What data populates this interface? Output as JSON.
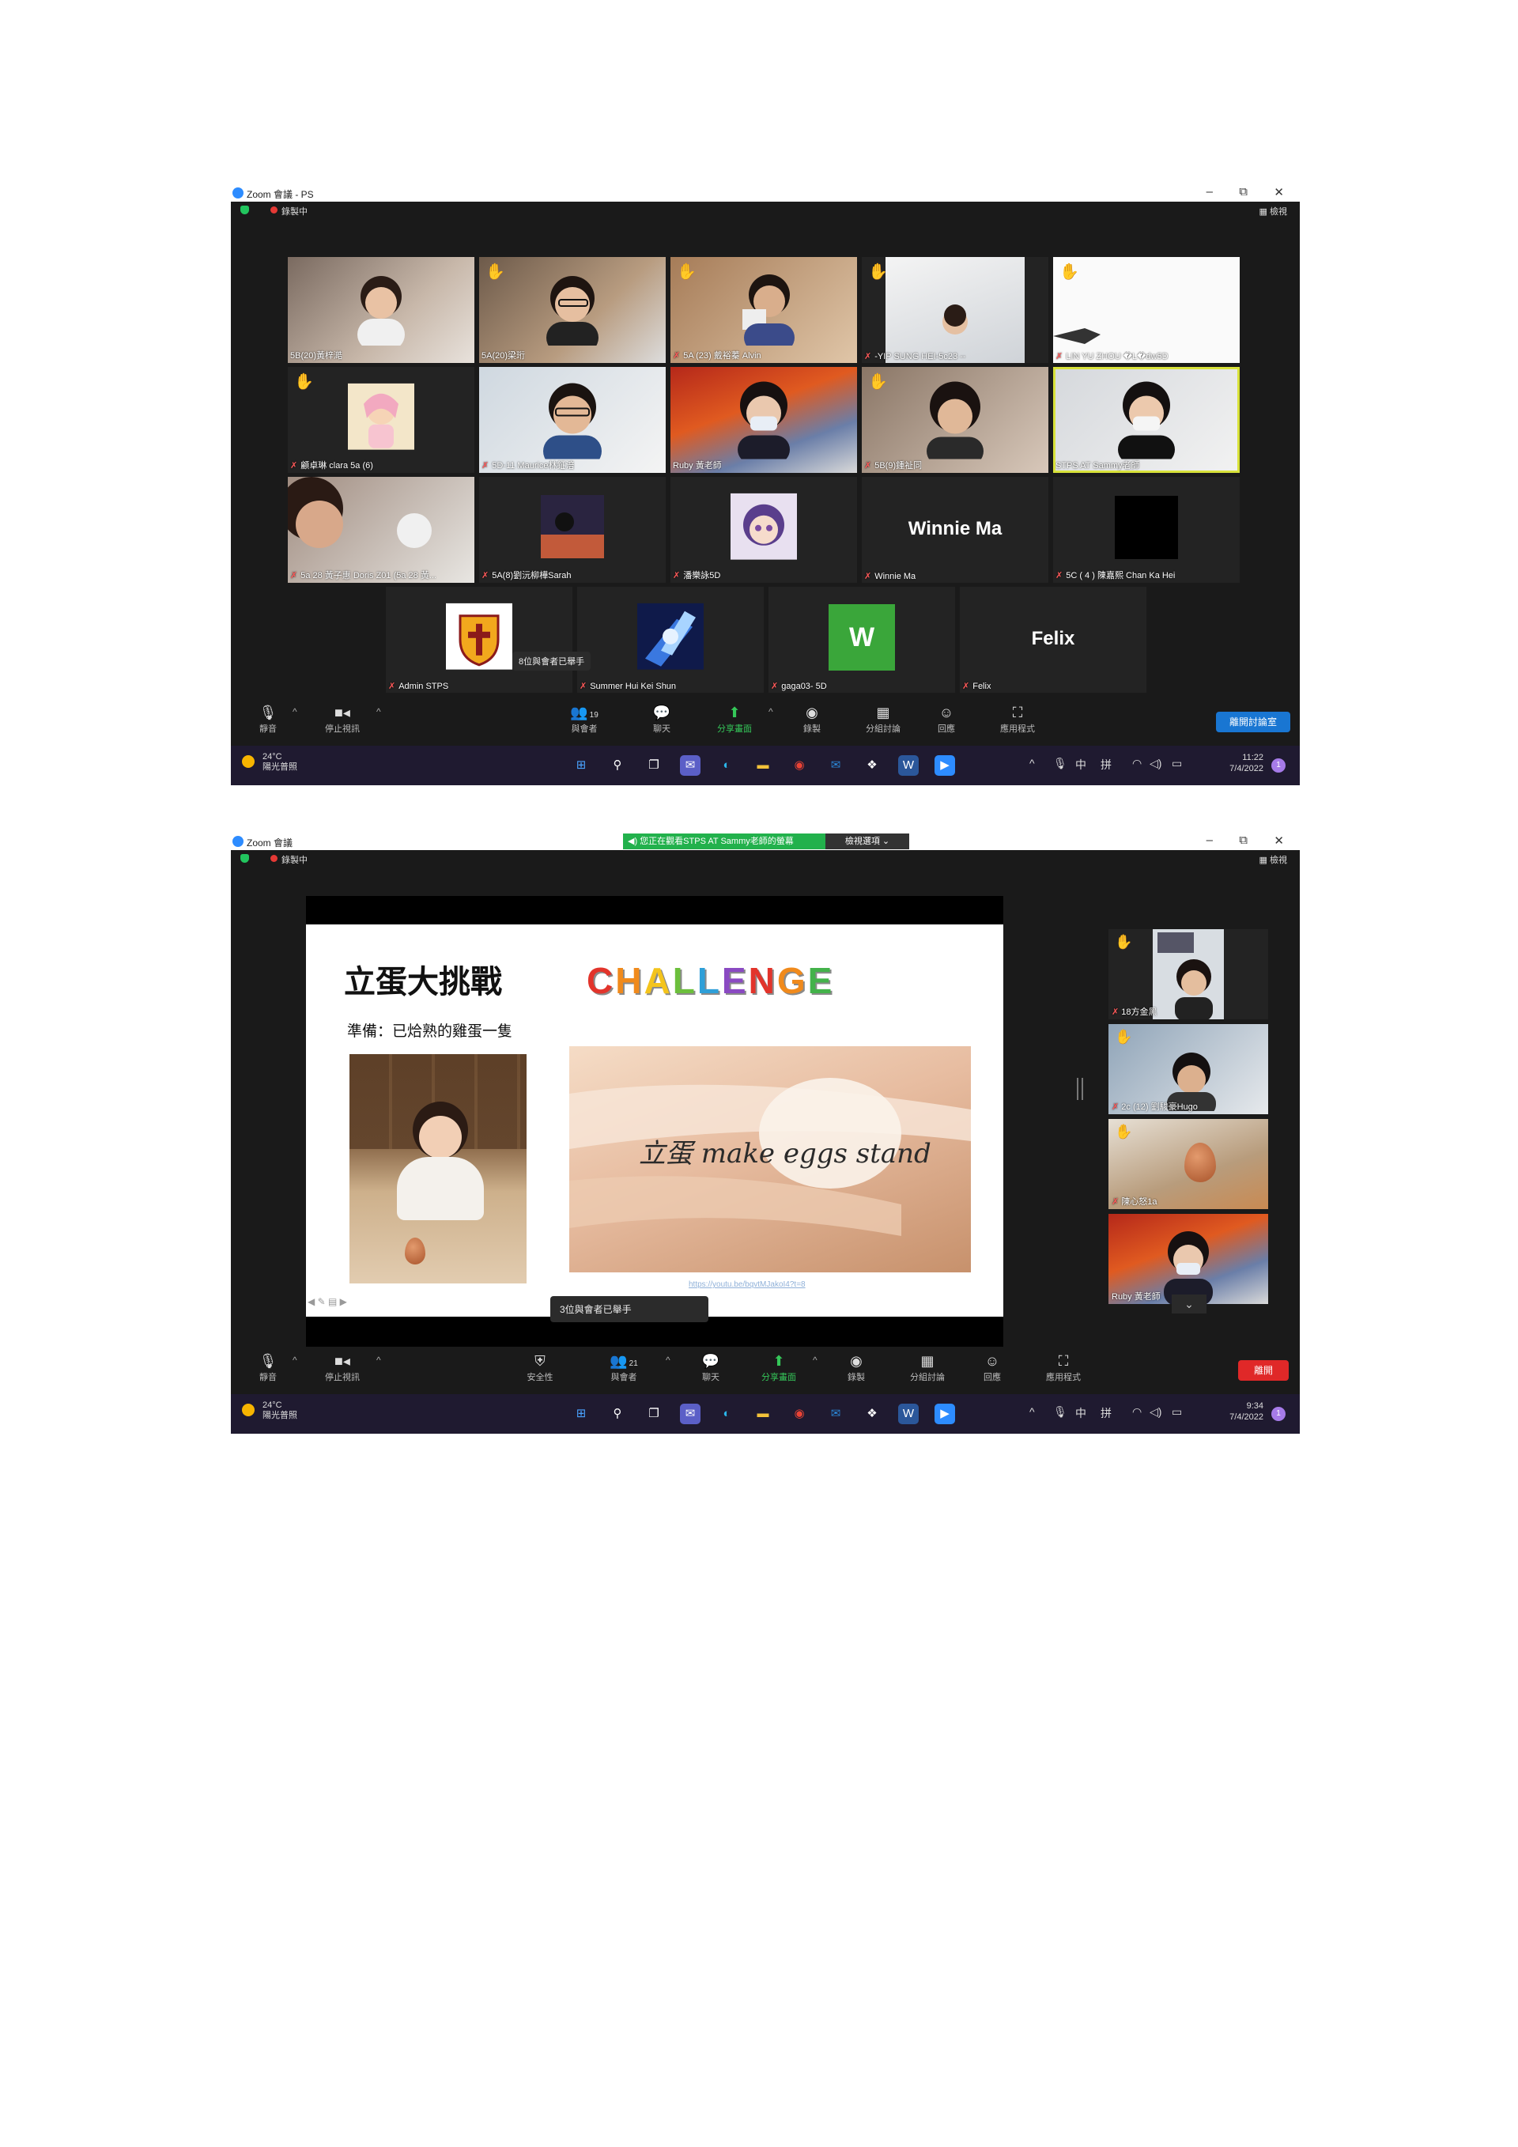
{
  "shot1": {
    "window_title": "Zoom 會議 - PS",
    "recording_label": "錄製中",
    "view_label": "檢視",
    "tiles": [
      {
        "name": "5B(20)黃梓澔",
        "hand": false,
        "muted": false
      },
      {
        "name": "5A(20)梁珩",
        "hand": true,
        "muted": false
      },
      {
        "name": "5A (23) 戴裕蓁 Alvin",
        "hand": true,
        "muted": true
      },
      {
        "name": "-YIP SUNG HEI-5c23 --",
        "hand": true,
        "muted": true
      },
      {
        "name": "LIN YU ZHOU �L�dw5D",
        "hand": true,
        "muted": true
      },
      {
        "name": "顧卓琳 clara 5a (6)",
        "hand": true,
        "muted": true
      },
      {
        "name": "5D-11 Maurice林鉦涪",
        "hand": false,
        "muted": true
      },
      {
        "name": "Ruby 黃老師",
        "hand": false,
        "muted": false
      },
      {
        "name": "5B(9)鍾祉同",
        "hand": true,
        "muted": true
      },
      {
        "name": "STPS AT Sammy老師",
        "hand": false,
        "muted": false
      },
      {
        "name": "5a 28 黃子惠 Doris Z01 (5a 28 黃...",
        "hand": false,
        "muted": true
      },
      {
        "name": "5A(8)劉沅柳樺Sarah",
        "hand": false,
        "muted": true
      },
      {
        "name": "潘樂詠5D",
        "hand": false,
        "muted": true
      },
      {
        "name": "Winnie Ma",
        "hand": false,
        "muted": true,
        "display_name": "Winnie Ma"
      },
      {
        "name": "5C ( 4 ) 陳嘉熙 Chan Ka Hei",
        "hand": false,
        "muted": true
      },
      {
        "name": "Admin STPS",
        "hand": false,
        "muted": true
      },
      {
        "name": "Summer Hui Kei Shun",
        "hand": false,
        "muted": true
      },
      {
        "name": "gaga03- 5D",
        "hand": false,
        "muted": true,
        "avatar_letter": "W"
      },
      {
        "name": "Felix",
        "hand": false,
        "muted": true,
        "display_name": "Felix"
      }
    ],
    "raised_hands_tip": "8位與會者已舉手",
    "toolbar": {
      "mute": "靜音",
      "stop_video": "停止視訊",
      "participants": "與會者",
      "participants_count": "19",
      "chat": "聊天",
      "share": "分享畫面",
      "record": "錄製",
      "breakout": "分組討論",
      "reactions": "回應",
      "apps": "應用程式",
      "leave": "離開討論室"
    },
    "taskbar": {
      "temp": "24°C",
      "weather": "陽光普照",
      "time": "11:22",
      "date": "7/4/2022",
      "ime1": "中",
      "ime2": "拼",
      "notifications": "1"
    }
  },
  "shot2": {
    "window_title": "Zoom 會議",
    "recording_label": "錄製中",
    "view_label": "檢視",
    "share_banner": "您正在觀看STPS AT Sammy老師的螢幕",
    "view_options": "檢視選項",
    "slide": {
      "title": "立蛋大挑戰",
      "prep": "準備：已烚熟的雞蛋一隻",
      "challenge_word": "CHALLENGE",
      "video_caption": "立蛋 make eggs stand",
      "link": "https://youtu.be/bqvtMJakoI4?t=8"
    },
    "raised_hands_tip": "3位與會者已舉手",
    "side_tiles": [
      {
        "name": "18方金黑",
        "hand": true
      },
      {
        "name": "2c (12) 劉駿豪Hugo",
        "hand": true
      },
      {
        "name": "陳心怒1a",
        "hand": true
      },
      {
        "name": "Ruby 黃老師",
        "hand": false
      }
    ],
    "toolbar": {
      "mute": "靜音",
      "stop_video": "停止視訊",
      "security": "安全性",
      "participants": "與會者",
      "participants_count": "21",
      "chat": "聊天",
      "share": "分享畫面",
      "record": "錄製",
      "breakout": "分組討論",
      "reactions": "回應",
      "apps": "應用程式",
      "leave": "離開"
    },
    "taskbar": {
      "temp": "24°C",
      "weather": "陽光普照",
      "time": "9:34",
      "date": "7/4/2022",
      "ime1": "中",
      "ime2": "拼",
      "notifications": "1"
    }
  },
  "colors": {
    "zoom_blue": "#2d8cff",
    "leave_blue": "#1976d2",
    "leave_red": "#e02828",
    "share_green": "#35c759",
    "active_speaker": "#d8e23a"
  },
  "icons": {
    "hand": "raised-hand-icon",
    "mic_off": "mic-off-icon"
  }
}
